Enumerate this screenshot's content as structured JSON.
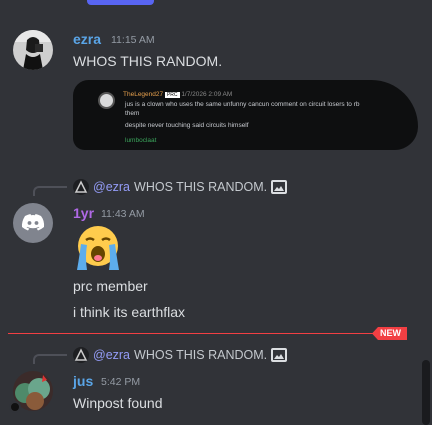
{
  "colors": {
    "background": "#313338",
    "username_blue": "#5aa5e7",
    "username_purple": "#b069e6",
    "mention": "#949cf7",
    "new_red": "#f23f43"
  },
  "messages": [
    {
      "username": "ezra",
      "timestamp": "11:15 AM",
      "lines": [
        "WHOS THIS RANDOM."
      ],
      "embed": {
        "author": "TheLegend27",
        "badge": "PRC",
        "date": "1/7/2026 2:09 AM",
        "lines": [
          "jus is a clown who uses the same unfunny cancun comment on circuit losers to rb",
          "them",
          "despite never touching said circuits himself"
        ],
        "footer_name": "lumboclaat"
      }
    },
    {
      "reply": {
        "mention": "@ezra",
        "text": "WHOS THIS RANDOM."
      },
      "username": "1yr",
      "timestamp": "11:43 AM",
      "emoji_icon": "loudly-crying-face-icon",
      "lines": [
        "prc member",
        "i think its earthflax"
      ]
    },
    {
      "reply": {
        "mention": "@ezra",
        "text": "WHOS THIS RANDOM."
      },
      "username": "jus",
      "timestamp": "5:42 PM",
      "lines": [
        "Winpost found"
      ]
    }
  ],
  "new_divider": {
    "label": "NEW"
  }
}
